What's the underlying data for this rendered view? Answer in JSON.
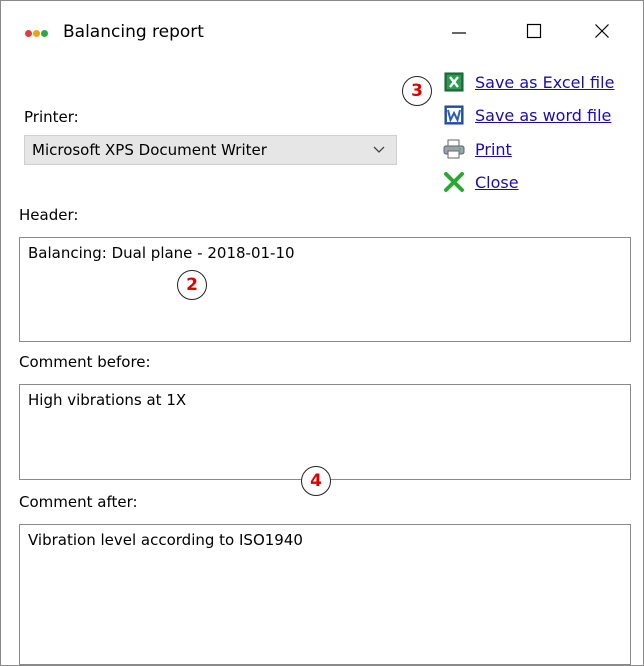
{
  "window": {
    "title": "Balancing report",
    "controls": {
      "minimize": "—",
      "maximize": "☐",
      "close": "✕"
    },
    "icon_colors": [
      "#e23c3c",
      "#e8a317",
      "#2aa84a"
    ]
  },
  "printer": {
    "label": "Printer:",
    "selected": "Microsoft XPS Document Writer"
  },
  "actions": [
    {
      "label": "Save as Excel file",
      "icon": "excel-icon"
    },
    {
      "label": "Save as word file",
      "icon": "word-icon"
    },
    {
      "label": "Print",
      "icon": "printer-icon"
    },
    {
      "label": "Close",
      "icon": "close-x-icon"
    }
  ],
  "header": {
    "label": "Header:",
    "value": "Balancing: Dual plane - 2018-01-10"
  },
  "comment_before": {
    "label": "Comment before:",
    "value": "High vibrations at 1X"
  },
  "comment_after": {
    "label": "Comment after:",
    "value": "Vibration level according to ISO1940"
  },
  "markers": [
    "2",
    "3",
    "4"
  ],
  "colors": {
    "link": "#1a0dab",
    "marker_text": "#e00000"
  }
}
